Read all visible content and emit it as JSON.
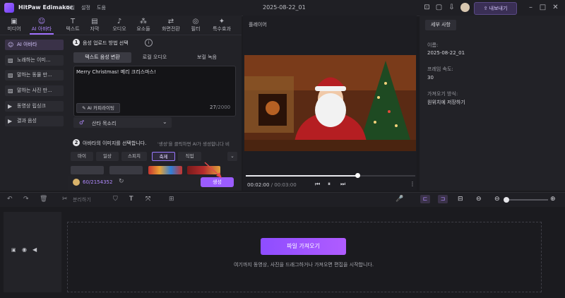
{
  "app": {
    "name": "HitPaw Edimakor",
    "menu": [
      "파일",
      "설정",
      "도움"
    ],
    "project_title": "2025-08-22_01",
    "export_label": "내보내기",
    "accent": "#9b5cff"
  },
  "tabs": [
    {
      "label": "미디어",
      "icon": "media-icon"
    },
    {
      "label": "AI 아바타",
      "icon": "avatar-icon"
    },
    {
      "label": "텍스트",
      "icon": "text-icon"
    },
    {
      "label": "자막",
      "icon": "subtitle-icon"
    },
    {
      "label": "오디오",
      "icon": "audio-icon"
    },
    {
      "label": "요소들",
      "icon": "elements-icon"
    },
    {
      "label": "화면전환",
      "icon": "transition-icon"
    },
    {
      "label": "필터",
      "icon": "filter-icon"
    },
    {
      "label": "특수효과",
      "icon": "effects-icon"
    }
  ],
  "sidebar": [
    {
      "label": "AI 아바타"
    },
    {
      "label": "노래하는 이미..."
    },
    {
      "label": "말하는 동물 만..."
    },
    {
      "label": "말하는 사진 만..."
    },
    {
      "label": "동영상 립싱크"
    },
    {
      "label": "결과 음성"
    }
  ],
  "step1": {
    "num": "1",
    "title": "음성 업로드 방법 선택",
    "segments": [
      "텍스트 음성 변환",
      "로컬 오디오",
      "보컬 녹음"
    ],
    "text": "Merry Christmas! 메리 크리스마스!",
    "ai_label": "AI 카피라이팅",
    "count": "27",
    "max": "/2000",
    "voice": "산타 목소리"
  },
  "step2": {
    "num": "2",
    "title": "아바타의 이미지를 선택합니다.",
    "hint": "'생성'을 클릭하면 AI가 생성합니다 비",
    "chips": [
      "마이",
      "일상",
      "스피치",
      "축제",
      "직업"
    ],
    "active_chip": 3
  },
  "credits": {
    "value": "60/2154352",
    "generate_label": "생성"
  },
  "player": {
    "title": "플레이어",
    "current": "00:02:00",
    "total": "/ 00:03:00",
    "progress": 0.66
  },
  "details": {
    "tab": "세부 사항",
    "fields": [
      {
        "label": "이름:",
        "value": "2025-08-22_01"
      },
      {
        "label": "프레임 속도:",
        "value": "30"
      },
      {
        "label": "가져오기 방식:",
        "value": "원위치에 저장하기"
      }
    ]
  },
  "timeline": {
    "split_label": "분리하기",
    "import_label": "파일 가져오기",
    "hint": "여기까지 동영상, 사진을 드래그하거나 가져오면 편집을 시작합니다."
  }
}
